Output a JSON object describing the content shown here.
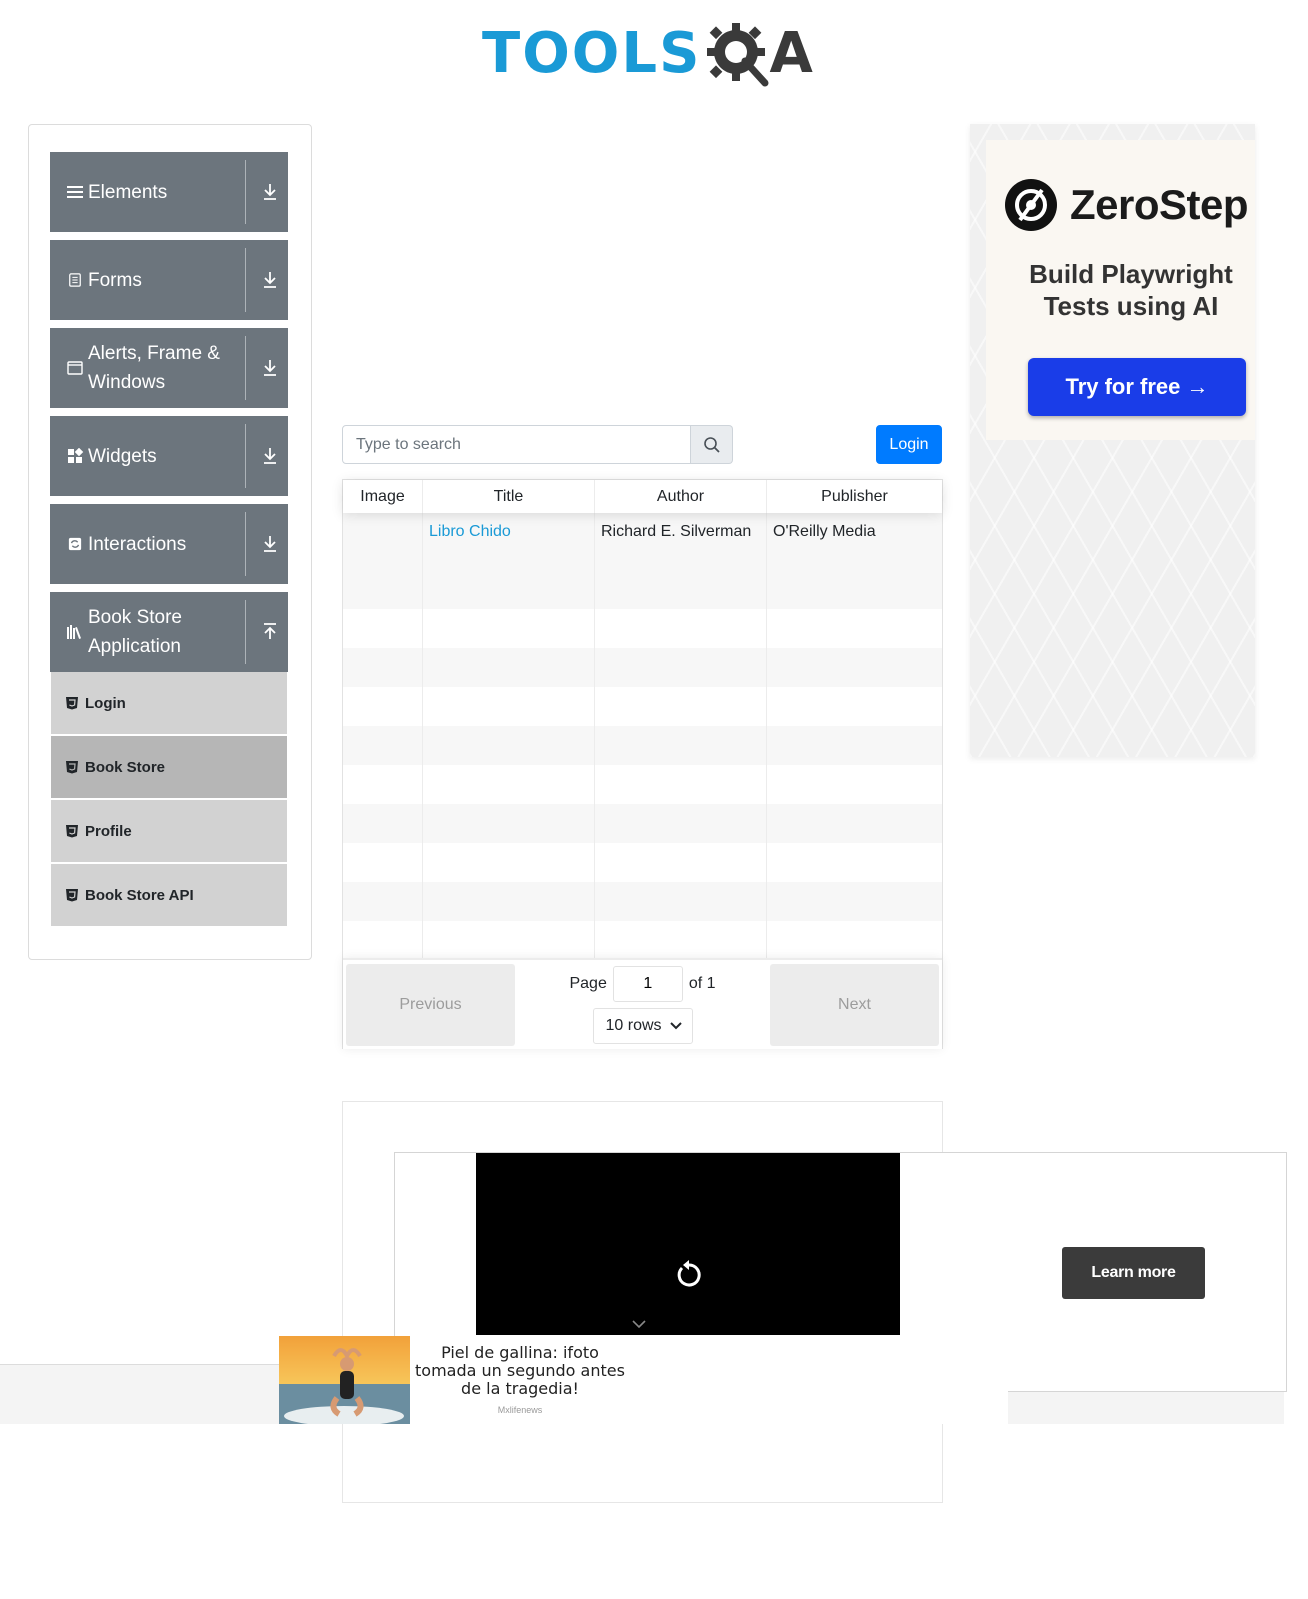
{
  "logo": {
    "tools": "TOOLS",
    "a": "A"
  },
  "sidebar": {
    "groups": [
      {
        "label": "Elements",
        "icon": "hamburger-icon"
      },
      {
        "label": "Forms",
        "icon": "document-icon"
      },
      {
        "label": "Alerts, Frame & Windows",
        "icon": "window-icon"
      },
      {
        "label": "Widgets",
        "icon": "widgets-icon"
      },
      {
        "label": "Interactions",
        "icon": "interactions-icon"
      },
      {
        "label": "Book Store Application",
        "icon": "books-icon"
      }
    ],
    "book_store_items": [
      {
        "label": "Login",
        "active": false
      },
      {
        "label": "Book Store",
        "active": true
      },
      {
        "label": "Profile",
        "active": false
      },
      {
        "label": "Book Store API",
        "active": false
      }
    ]
  },
  "search": {
    "placeholder": "Type to search",
    "icon": "search-icon"
  },
  "login_button": "Login",
  "table": {
    "columns": [
      "Image",
      "Title",
      "Author",
      "Publisher"
    ],
    "rows": [
      {
        "image": "",
        "title": "Libro Chido",
        "author": "Richard E. Silverman",
        "publisher": "O'Reilly Media"
      }
    ],
    "empty_rows": 9
  },
  "pagination": {
    "previous": "Previous",
    "next": "Next",
    "page_label": "Page",
    "page_value": "1",
    "of_label": "of 1",
    "rows_select": "10 rows"
  },
  "ad_right": {
    "brand": "ZeroStep",
    "tagline_line1": "Build Playwright",
    "tagline_line2": "Tests using AI",
    "cta": "Try for free →"
  },
  "video_ad": {
    "learn_more": "Learn more"
  },
  "news_ad": {
    "title": "Piel de gallina: ifoto tomada un segundo antes de la tragedia!",
    "source": "Mxlifenews"
  },
  "colors": {
    "sidebar_header": "#6c757d",
    "primary": "#007bff",
    "logo_blue": "#1a9ad6",
    "link": "#1a9ad6",
    "cta_blue": "#1a3de8"
  }
}
